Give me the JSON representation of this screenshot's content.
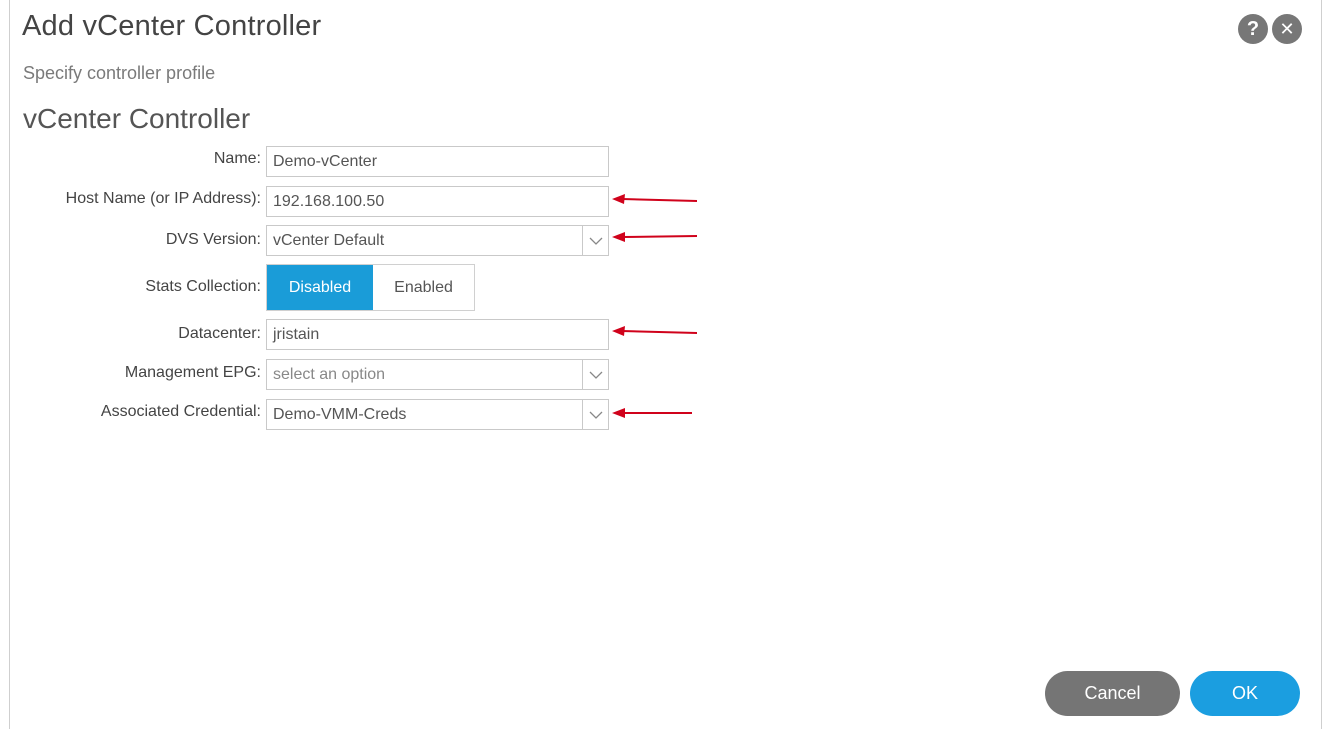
{
  "dialog": {
    "title": "Add vCenter Controller",
    "subtitle": "Specify controller profile",
    "section_title": "vCenter Controller",
    "help_icon": "?",
    "close_icon": "✕"
  },
  "form": {
    "name_label": "Name:",
    "name_value": "Demo-vCenter",
    "host_label": "Host Name (or IP Address):",
    "host_value": "192.168.100.50",
    "dvs_label": "DVS Version:",
    "dvs_value": "vCenter Default",
    "stats_label": "Stats Collection:",
    "stats_options": [
      "Disabled",
      "Enabled"
    ],
    "stats_selected": "Disabled",
    "datacenter_label": "Datacenter:",
    "datacenter_value": "jristain",
    "mgmt_epg_label": "Management EPG:",
    "mgmt_epg_placeholder": "select an option",
    "credential_label": "Associated Credential:",
    "credential_value": "Demo-VMM-Creds"
  },
  "buttons": {
    "cancel": "Cancel",
    "ok": "OK"
  },
  "colors": {
    "accent": "#1a9cd8",
    "annotation_arrow": "#d0021b",
    "cancel_button": "#757575"
  }
}
